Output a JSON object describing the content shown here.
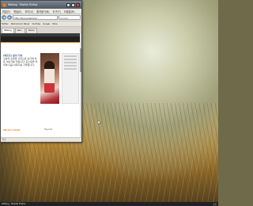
{
  "window": {
    "title": "Weblog · Mozilla Firefox",
    "menu": [
      "파일(F)",
      "편집(E)",
      "보기(V)",
      "즐겨찾기(B)",
      "도구(T)",
      "도움말(H)"
    ],
    "url": "http://blog.example/...",
    "search_placeholder": "Google",
    "bookmarks": [
      "Twitter",
      "Welcome to Naver",
      "YouTube",
      "Google",
      "More"
    ],
    "tabs": [
      "Weblog",
      "Gaz...",
      "Naver"
    ],
    "status": "완료"
  },
  "page": {
    "article_head": "[레포트] 삶의 기록",
    "article_body": "오늘의 모습을 사진으로 남기며 작은 이야기를 전합니다. 포스팅을 마치며 다음 이야기를 기약합니다.",
    "bottom_left": "What's Read",
    "bottom_right": "Tag List"
  },
  "taskbar": {
    "items": [
      "Weblog · Mozilla Firefox"
    ],
    "tray": "오후"
  },
  "colors": {
    "accent": "#e08a22",
    "link": "#2f5a96"
  }
}
